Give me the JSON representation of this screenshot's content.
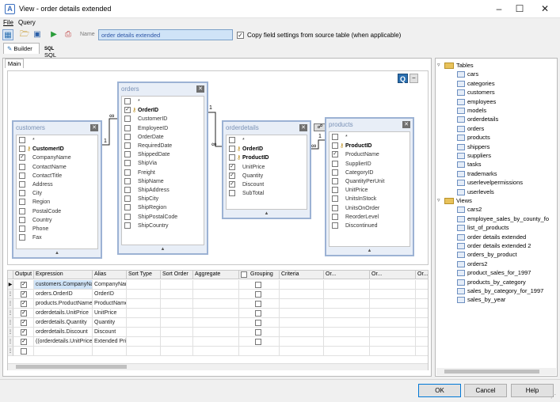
{
  "window": {
    "title": "View - order details extended",
    "app_icon_letter": "A"
  },
  "menu": [
    "File",
    "Query"
  ],
  "toolbar": {
    "name_label": "Name",
    "name_value": "order details extended",
    "copy_settings_label": "Copy field settings from source table (when applicable)",
    "copy_settings_checked": true
  },
  "tabs": {
    "builder": "Builder",
    "sql": "SQL",
    "main": "Main"
  },
  "tables": {
    "customers": {
      "title": "customers",
      "fields": [
        {
          "name": "*",
          "checked": false,
          "pk": false
        },
        {
          "name": "CustomerID",
          "checked": false,
          "pk": true
        },
        {
          "name": "CompanyName",
          "checked": true,
          "pk": false
        },
        {
          "name": "ContactName",
          "checked": false,
          "pk": false
        },
        {
          "name": "ContactTitle",
          "checked": false,
          "pk": false
        },
        {
          "name": "Address",
          "checked": false,
          "pk": false
        },
        {
          "name": "City",
          "checked": false,
          "pk": false
        },
        {
          "name": "Region",
          "checked": false,
          "pk": false
        },
        {
          "name": "PostalCode",
          "checked": false,
          "pk": false
        },
        {
          "name": "Country",
          "checked": false,
          "pk": false
        },
        {
          "name": "Phone",
          "checked": false,
          "pk": false
        },
        {
          "name": "Fax",
          "checked": false,
          "pk": false
        }
      ]
    },
    "orders": {
      "title": "orders",
      "fields": [
        {
          "name": "*",
          "checked": false,
          "pk": false
        },
        {
          "name": "OrderID",
          "checked": true,
          "pk": true
        },
        {
          "name": "CustomerID",
          "checked": false,
          "pk": false
        },
        {
          "name": "EmployeeID",
          "checked": false,
          "pk": false
        },
        {
          "name": "OrderDate",
          "checked": false,
          "pk": false
        },
        {
          "name": "RequiredDate",
          "checked": false,
          "pk": false
        },
        {
          "name": "ShippedDate",
          "checked": false,
          "pk": false
        },
        {
          "name": "ShipVia",
          "checked": false,
          "pk": false
        },
        {
          "name": "Freight",
          "checked": false,
          "pk": false
        },
        {
          "name": "ShipName",
          "checked": false,
          "pk": false
        },
        {
          "name": "ShipAddress",
          "checked": false,
          "pk": false
        },
        {
          "name": "ShipCity",
          "checked": false,
          "pk": false
        },
        {
          "name": "ShipRegion",
          "checked": false,
          "pk": false
        },
        {
          "name": "ShipPostalCode",
          "checked": false,
          "pk": false
        },
        {
          "name": "ShipCountry",
          "checked": false,
          "pk": false
        }
      ]
    },
    "orderdetails": {
      "title": "orderdetails",
      "fields": [
        {
          "name": "*",
          "checked": false,
          "pk": false
        },
        {
          "name": "OrderID",
          "checked": false,
          "pk": true
        },
        {
          "name": "ProductID",
          "checked": false,
          "pk": true
        },
        {
          "name": "UnitPrice",
          "checked": true,
          "pk": false
        },
        {
          "name": "Quantity",
          "checked": true,
          "pk": false
        },
        {
          "name": "Discount",
          "checked": true,
          "pk": false
        },
        {
          "name": "SubTotal",
          "checked": false,
          "pk": false
        }
      ]
    },
    "products": {
      "title": "products",
      "fields": [
        {
          "name": "*",
          "checked": false,
          "pk": false
        },
        {
          "name": "ProductID",
          "checked": false,
          "pk": true
        },
        {
          "name": "ProductName",
          "checked": true,
          "pk": false
        },
        {
          "name": "SupplierID",
          "checked": false,
          "pk": false
        },
        {
          "name": "CategoryID",
          "checked": false,
          "pk": false
        },
        {
          "name": "QuantityPerUnit",
          "checked": false,
          "pk": false
        },
        {
          "name": "UnitPrice",
          "checked": false,
          "pk": false
        },
        {
          "name": "UnitsInStock",
          "checked": false,
          "pk": false
        },
        {
          "name": "UnitsOnOrder",
          "checked": false,
          "pk": false
        },
        {
          "name": "ReorderLevel",
          "checked": false,
          "pk": false
        },
        {
          "name": "Discontinued",
          "checked": false,
          "pk": false
        }
      ]
    }
  },
  "relations": {
    "one": "1",
    "many": "∞"
  },
  "grid": {
    "columns": [
      "Output",
      "Expression",
      "Alias",
      "Sort Type",
      "Sort Order",
      "Aggregate",
      "Grouping",
      "Criteria",
      "Or...",
      "Or...",
      "Or..."
    ],
    "rows": [
      {
        "output": true,
        "expression": "customers.CompanyName",
        "alias": "CompanyName",
        "grouping": false
      },
      {
        "output": true,
        "expression": "orders.OrderID",
        "alias": "OrderID",
        "grouping": false
      },
      {
        "output": true,
        "expression": "products.ProductName",
        "alias": "ProductName",
        "grouping": false
      },
      {
        "output": true,
        "expression": "orderdetails.UnitPrice",
        "alias": "UnitPrice",
        "grouping": false
      },
      {
        "output": true,
        "expression": "orderdetails.Quantity",
        "alias": "Quantity",
        "grouping": false
      },
      {
        "output": true,
        "expression": "orderdetails.Discount",
        "alias": "Discount",
        "grouping": false
      },
      {
        "output": true,
        "expression": "((orderdetails.UnitPrice",
        "alias": "Extended Price",
        "grouping": false
      },
      {
        "output": false,
        "expression": "",
        "alias": "",
        "grouping": false
      }
    ]
  },
  "tree": {
    "tables_label": "Tables",
    "tables": [
      "cars",
      "categories",
      "customers",
      "employees",
      "models",
      "orderdetails",
      "orders",
      "products",
      "shippers",
      "suppliers",
      "tasks",
      "trademarks",
      "userlevelpermissions",
      "userlevels"
    ],
    "views_label": "Views",
    "views": [
      "cars2",
      "employee_sales_by_county_fo",
      "list_of_products",
      "order details extended",
      "order details extended 2",
      "orders_by_product",
      "orders2",
      "product_sales_for_1997",
      "products_by_category",
      "sales_by_category_for_1997",
      "sales_by_year"
    ]
  },
  "buttons": {
    "ok": "OK",
    "cancel": "Cancel",
    "help": "Help"
  },
  "colors": {
    "table_border": "#9cb2d4",
    "selection": "#cfe3f7",
    "accent": "#0078d7"
  }
}
